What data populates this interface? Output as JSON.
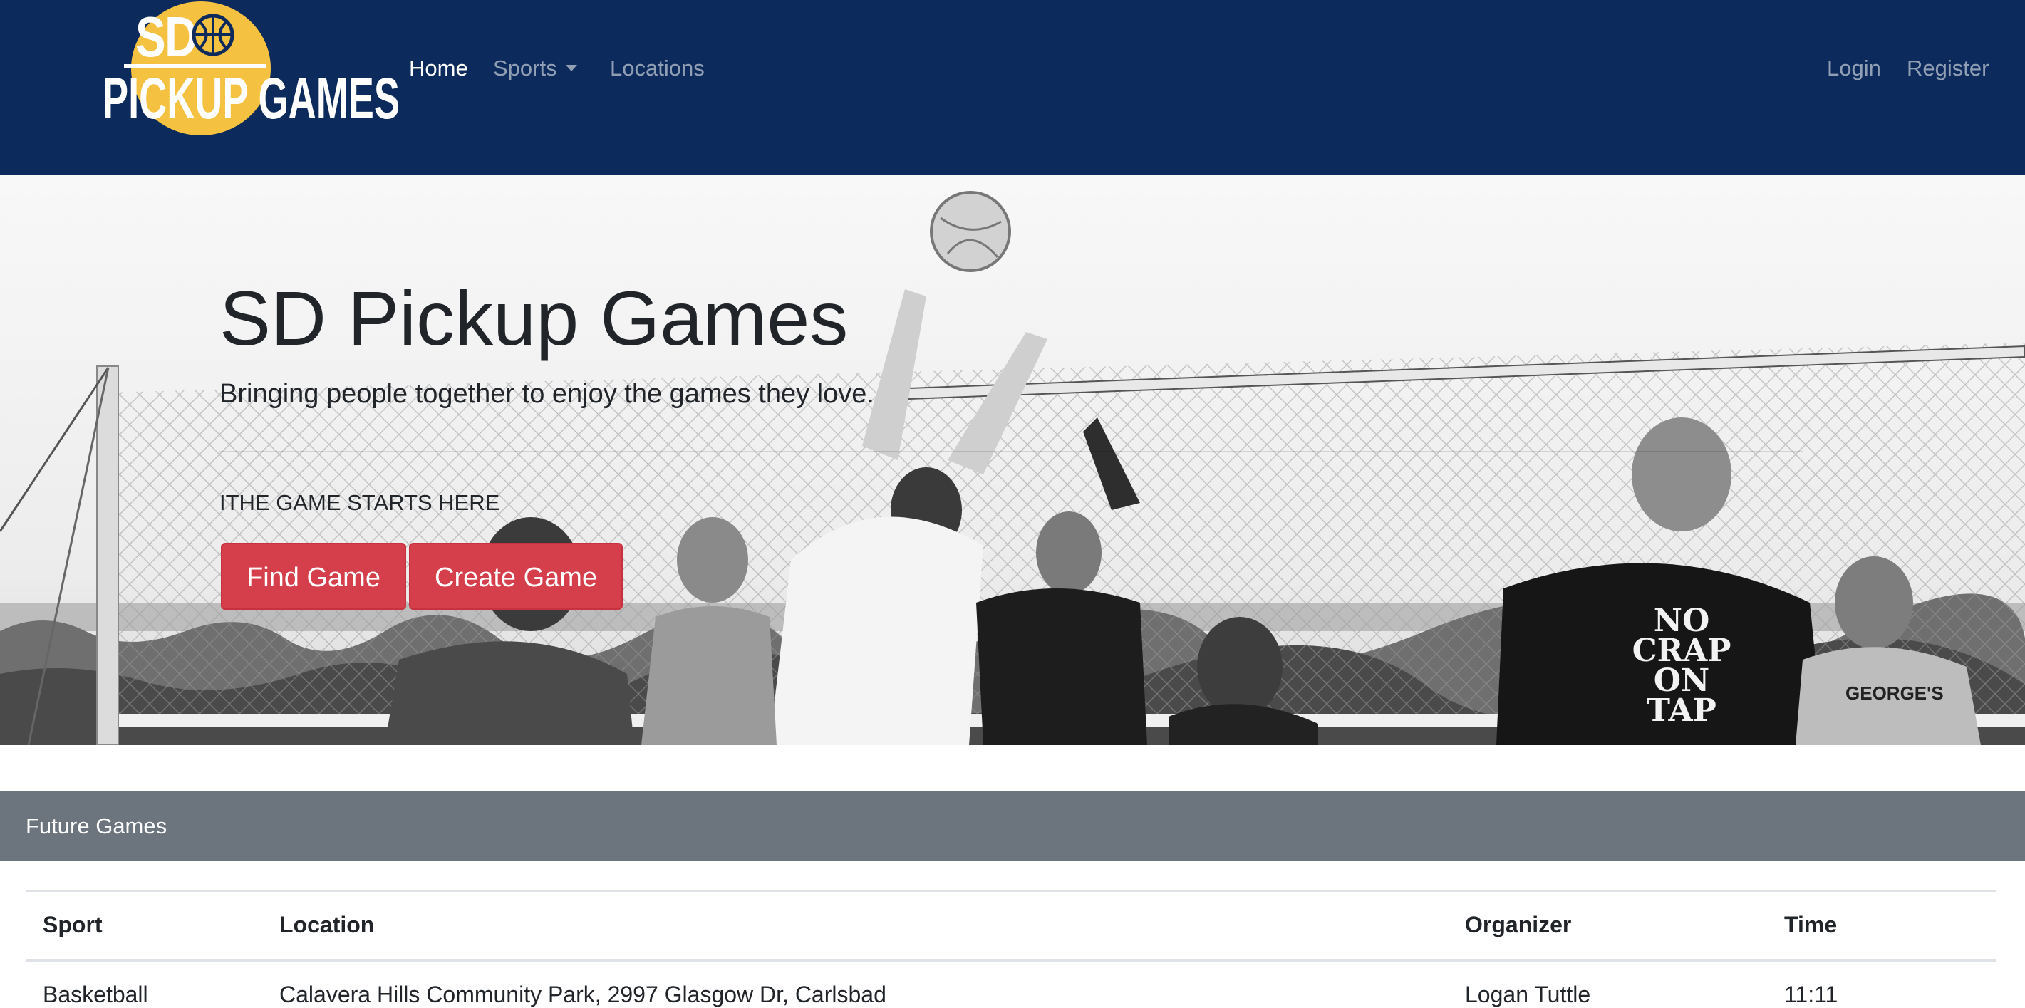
{
  "brand": {
    "logo_line1": "SD",
    "logo_line2": "PICKUP GAMES",
    "colors": {
      "navbar": "#0c2a5b",
      "logo_sun": "#f4c141",
      "button": "#d43f4b",
      "card_header": "#6c757d"
    }
  },
  "nav": {
    "home": "Home",
    "sports": "Sports",
    "locations": "Locations",
    "login": "Login",
    "register": "Register"
  },
  "hero": {
    "title": "SD Pickup Games",
    "subtitle": "Bringing people together to enjoy the games they love.",
    "lead": "ITHE GAME STARTS HERE",
    "find_button": "Find Game",
    "create_button": "Create Game",
    "image": "black-and-white beach volleyball players at the net",
    "shirt_text": [
      "NO",
      "CRAP",
      "ON",
      "TAP"
    ],
    "jersey_text": "GEORGE'S"
  },
  "future_games": {
    "header": "Future Games",
    "columns": [
      "Sport",
      "Location",
      "Organizer",
      "Time"
    ],
    "rows": [
      [
        "Basketball",
        "Calavera Hills Community Park, 2997 Glasgow Dr, Carlsbad",
        "Logan Tuttle",
        "11:11"
      ]
    ]
  }
}
